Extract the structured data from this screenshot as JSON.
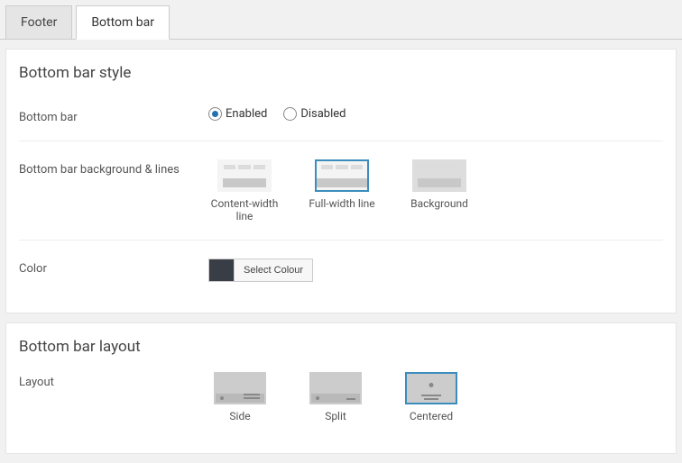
{
  "tabs": {
    "footer": "Footer",
    "bottom_bar": "Bottom bar",
    "active": "bottom_bar"
  },
  "section_style": {
    "heading": "Bottom bar style",
    "bottom_bar_label": "Bottom bar",
    "enabled_label": "Enabled",
    "disabled_label": "Disabled",
    "bottom_bar_value": "enabled",
    "bg_lines_label": "Bottom bar background & lines",
    "bg_lines_options": [
      {
        "key": "content-width",
        "label": "Content-width line"
      },
      {
        "key": "full-width",
        "label": "Full-width line"
      },
      {
        "key": "background",
        "label": "Background"
      }
    ],
    "bg_lines_selected": "full-width",
    "color_label": "Color",
    "select_colour_btn": "Select Colour",
    "color_hex": "#393e46"
  },
  "section_layout": {
    "heading": "Bottom bar layout",
    "layout_label": "Layout",
    "options": [
      {
        "key": "side",
        "label": "Side"
      },
      {
        "key": "split",
        "label": "Split"
      },
      {
        "key": "centered",
        "label": "Centered"
      }
    ],
    "selected": "centered"
  }
}
